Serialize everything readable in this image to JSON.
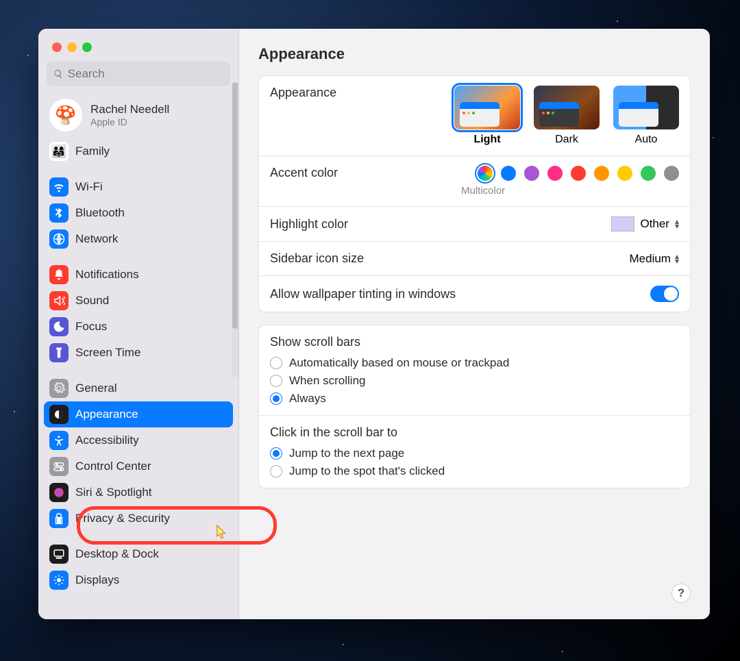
{
  "search": {
    "placeholder": "Search"
  },
  "user": {
    "name": "Rachel Needell",
    "sub": "Apple ID"
  },
  "sidebar": {
    "family": "Family",
    "g1": [
      {
        "label": "Wi-Fi",
        "bg": "#0a7aff"
      },
      {
        "label": "Bluetooth",
        "bg": "#0a7aff"
      },
      {
        "label": "Network",
        "bg": "#0a7aff"
      }
    ],
    "g2": [
      {
        "label": "Notifications",
        "bg": "#ff3b30"
      },
      {
        "label": "Sound",
        "bg": "#ff3b30"
      },
      {
        "label": "Focus",
        "bg": "#5856d6"
      },
      {
        "label": "Screen Time",
        "bg": "#5856d6"
      }
    ],
    "g3": [
      {
        "label": "General",
        "bg": "#9a9aa0"
      },
      {
        "label": "Appearance",
        "bg": "#1c1c1e",
        "selected": true
      },
      {
        "label": "Accessibility",
        "bg": "#0a7aff"
      },
      {
        "label": "Control Center",
        "bg": "#9a9aa0",
        "ring": true
      },
      {
        "label": "Siri & Spotlight",
        "bg": "#1c1c1e"
      },
      {
        "label": "Privacy & Security",
        "bg": "#0a7aff"
      }
    ],
    "g4": [
      {
        "label": "Desktop & Dock",
        "bg": "#1c1c1e"
      },
      {
        "label": "Displays",
        "bg": "#0a7aff"
      }
    ]
  },
  "main": {
    "title": "Appearance",
    "appearance_label": "Appearance",
    "themes": {
      "light": "Light",
      "dark": "Dark",
      "auto": "Auto",
      "selected": "Light"
    },
    "accent_label": "Accent color",
    "accent_hint": "Multicolor",
    "accent_colors": [
      "multi",
      "#0a7aff",
      "#a855d6",
      "#ff2d87",
      "#ff3b30",
      "#ff9500",
      "#ffcc00",
      "#34c759",
      "#8e8e93"
    ],
    "accent_selected": 0,
    "highlight_label": "Highlight color",
    "highlight_value": "Other",
    "sidebar_size_label": "Sidebar icon size",
    "sidebar_size_value": "Medium",
    "tinting_label": "Allow wallpaper tinting in windows",
    "tinting_on": true,
    "scroll_title": "Show scroll bars",
    "scroll_opts": [
      "Automatically based on mouse or trackpad",
      "When scrolling",
      "Always"
    ],
    "scroll_selected": 2,
    "click_title": "Click in the scroll bar to",
    "click_opts": [
      "Jump to the next page",
      "Jump to the spot that's clicked"
    ],
    "click_selected": 0,
    "help": "?"
  }
}
